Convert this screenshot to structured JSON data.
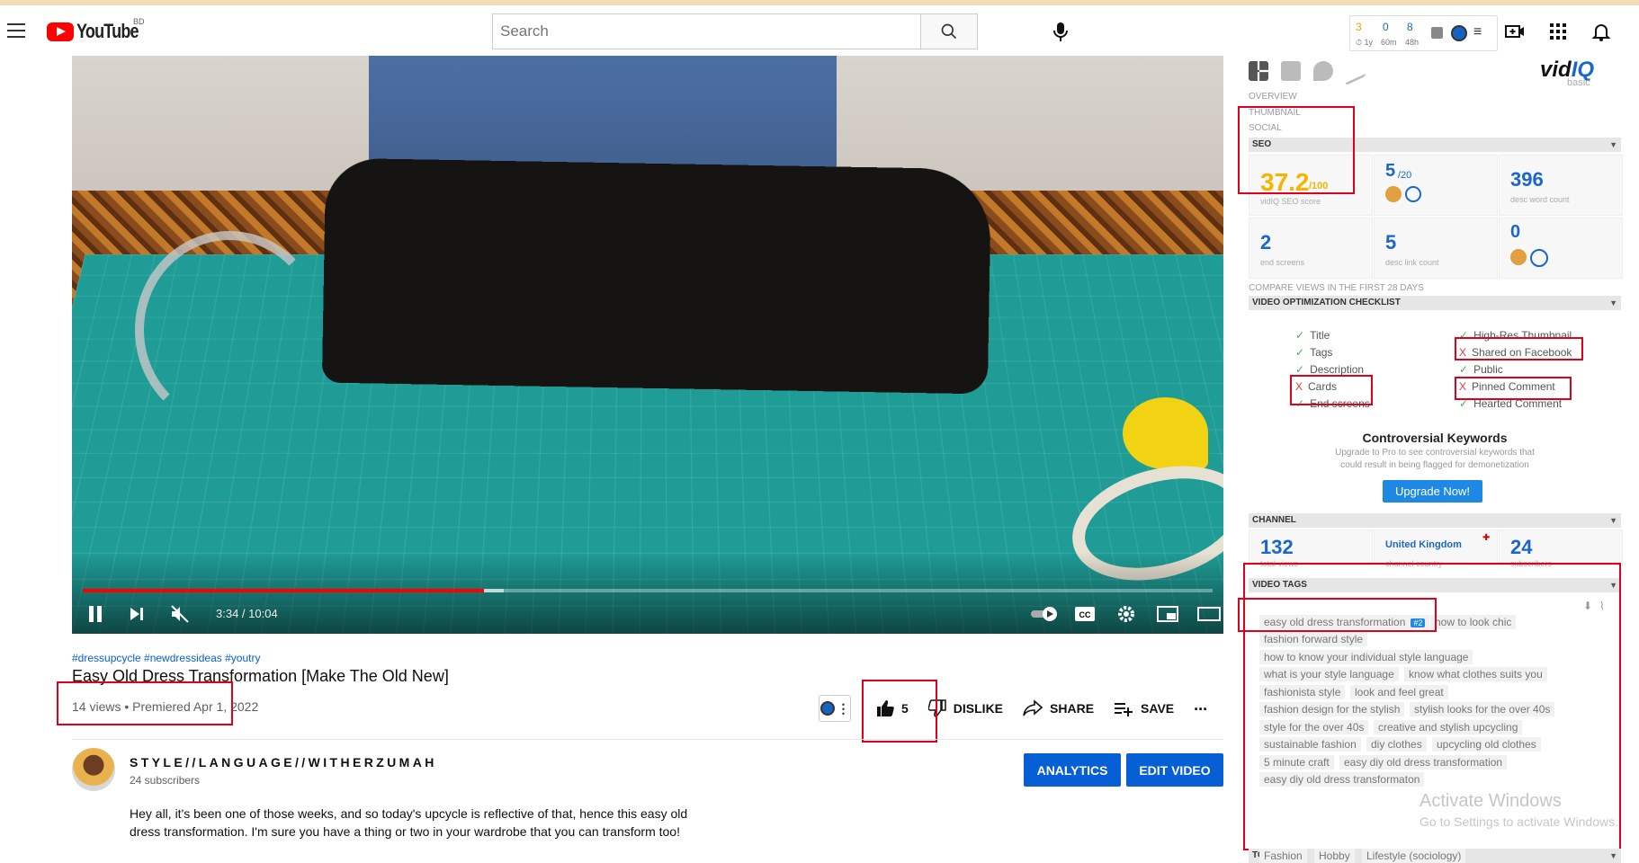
{
  "app": {
    "logo_text": "YouTube",
    "country_code": "BD"
  },
  "search": {
    "placeholder": "Search"
  },
  "header_stats": {
    "items": [
      {
        "value": "3",
        "label": "1y",
        "color": "#f4a300"
      },
      {
        "value": "0",
        "label": "60m",
        "color": "#1b66c9"
      },
      {
        "value": "8",
        "label": "48h",
        "color": "#1b66c9"
      }
    ]
  },
  "player": {
    "time": "3:34 / 10:04",
    "progress_fraction": 0.355,
    "buffer_fraction": 0.373
  },
  "video": {
    "hashtags": "#dressupcycle #newdressideas #youtry",
    "title": "Easy Old Dress Transformation [Make The Old New]",
    "meta": "14 views • Premiered Apr 1, 2022",
    "likes": "5",
    "dislike_label": "DISLIKE",
    "share_label": "SHARE",
    "save_label": "SAVE",
    "more_label": "..."
  },
  "channel": {
    "name": "STYLE//LANGUAGE//WITHERZUMAH",
    "subscribers": "24 subscribers",
    "analytics_label": "ANALYTICS",
    "edit_label": "EDIT VIDEO"
  },
  "description": "Hey all, it's been one of those weeks, and so today's upcycle is reflective of that, hence this easy old dress transformation. I'm sure you have a thing or two in your wardrobe that you can transform too!",
  "vidiq": {
    "logo_a": "vid",
    "logo_b": "IQ",
    "plan": "basic",
    "sections": {
      "overview": "OVERVIEW",
      "thumbnail": "THUMBNAIL",
      "social": "SOCIAL",
      "seo": "SEO",
      "compare": "COMPARE VIEWS IN THE FIRST 28 DAYS",
      "checklist": "VIDEO OPTIMIZATION CHECKLIST",
      "channel": "CHANNEL",
      "video_tags": "VIDEO TAGS",
      "topics": "TOPICS"
    },
    "seo": {
      "score": "37.2",
      "score_max": "/100",
      "score_label": "vidIQ SEO score",
      "tags_count": "5",
      "tags_max": "/20",
      "desc_word_count": "396",
      "desc_word_label": "desc word count",
      "end_screens": "2",
      "end_screens_label": "end screens",
      "desc_link_count": "5",
      "desc_link_label": "desc link count",
      "cards_count": "0"
    },
    "checklist_left": [
      {
        "label": "Title",
        "ok": true
      },
      {
        "label": "Tags",
        "ok": true
      },
      {
        "label": "Description",
        "ok": true
      },
      {
        "label": "Cards",
        "ok": false
      },
      {
        "label": "End screens",
        "ok": true
      }
    ],
    "checklist_right": [
      {
        "label": "High-Res Thumbnail",
        "ok": true
      },
      {
        "label": "Shared on Facebook",
        "ok": false
      },
      {
        "label": "Public",
        "ok": true
      },
      {
        "label": "Pinned Comment",
        "ok": false
      },
      {
        "label": "Hearted Comment",
        "ok": true
      }
    ],
    "check_mark": "✓",
    "cross_mark": "X",
    "controversial": {
      "title": "Controversial Keywords",
      "text": "Upgrade to Pro to see controversial keywords that could result in being flagged for demonetization",
      "button": "Upgrade Now!"
    },
    "channel_stats": {
      "total_views": "132",
      "total_views_label": "total views",
      "country": "United Kingdom",
      "country_label": "channel country",
      "subscribers": "24",
      "subscribers_label": "subscribers"
    },
    "video_tags": [
      "easy old dress transformation",
      "how to look chic",
      "fashion forward style",
      "how to know your individual style language",
      "what is your style language",
      "know what clothes suits you",
      "fashionista style",
      "look and feel great",
      "fashion design for the stylish",
      "stylish looks for the over 40s",
      "style for the over 40s",
      "creative and stylish upcycling",
      "sustainable fashion",
      "diy clothes",
      "upcycling old clothes",
      "5 minute craft",
      "easy diy old dress transformation",
      "easy diy old dress transformaton"
    ],
    "tag_rank": "#2",
    "topics": [
      "Fashion",
      "Hobby",
      "Lifestyle (sociology)"
    ]
  },
  "watermark": {
    "line1": "Activate Windows",
    "line2": "Go to Settings to activate Windows."
  },
  "colors": {
    "accent": "#065fd4",
    "red": "#ff0000",
    "vidiq_blue": "#1b66c9",
    "seo_score": "#f4b400",
    "highlight_box": "#e0001b"
  }
}
